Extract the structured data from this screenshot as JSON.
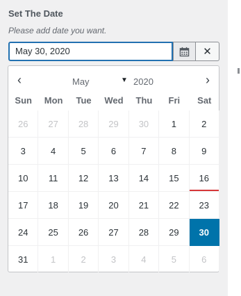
{
  "field": {
    "label": "Set The Date",
    "description": "Please add date you want.",
    "value": "May 30, 2020",
    "calendar_icon": "calendar-icon",
    "clear_icon": "close-icon",
    "clear_label": "✕"
  },
  "picker": {
    "prev_icon": "chevron-left-icon",
    "prev_label": "‹",
    "next_icon": "chevron-right-icon",
    "next_label": "›",
    "month": "May",
    "year": "2020",
    "weekdays": [
      "Sun",
      "Mon",
      "Tue",
      "Wed",
      "Thu",
      "Fri",
      "Sat"
    ],
    "weeks": [
      [
        {
          "d": "26",
          "other": true
        },
        {
          "d": "27",
          "other": true
        },
        {
          "d": "28",
          "other": true
        },
        {
          "d": "29",
          "other": true
        },
        {
          "d": "30",
          "other": true
        },
        {
          "d": "1"
        },
        {
          "d": "2"
        }
      ],
      [
        {
          "d": "3"
        },
        {
          "d": "4"
        },
        {
          "d": "5"
        },
        {
          "d": "6"
        },
        {
          "d": "7"
        },
        {
          "d": "8"
        },
        {
          "d": "9"
        }
      ],
      [
        {
          "d": "10"
        },
        {
          "d": "11"
        },
        {
          "d": "12"
        },
        {
          "d": "13"
        },
        {
          "d": "14"
        },
        {
          "d": "15"
        },
        {
          "d": "16",
          "today": true
        }
      ],
      [
        {
          "d": "17"
        },
        {
          "d": "18"
        },
        {
          "d": "19"
        },
        {
          "d": "20"
        },
        {
          "d": "21"
        },
        {
          "d": "22"
        },
        {
          "d": "23"
        }
      ],
      [
        {
          "d": "24"
        },
        {
          "d": "25"
        },
        {
          "d": "26"
        },
        {
          "d": "27"
        },
        {
          "d": "28"
        },
        {
          "d": "29"
        },
        {
          "d": "30",
          "selected": true
        }
      ],
      [
        {
          "d": "31"
        },
        {
          "d": "1",
          "other": true
        },
        {
          "d": "2",
          "other": true
        },
        {
          "d": "3",
          "other": true
        },
        {
          "d": "4",
          "other": true
        },
        {
          "d": "5",
          "other": true
        },
        {
          "d": "6",
          "other": true
        }
      ]
    ],
    "selected_color": "#0073aa",
    "today_marker_color": "#d63638"
  }
}
